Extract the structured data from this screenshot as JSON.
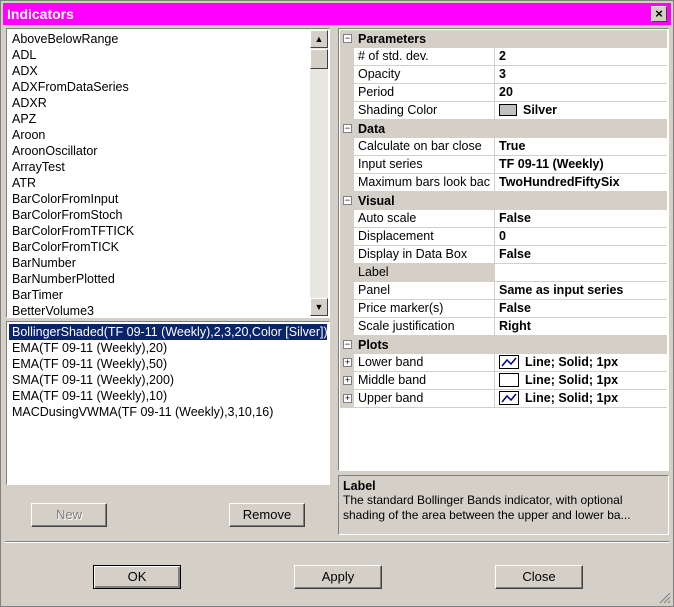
{
  "window": {
    "title": "Indicators"
  },
  "indicator_list": {
    "items": [
      "AboveBelowRange",
      "ADL",
      "ADX",
      "ADXFromDataSeries",
      "ADXR",
      "APZ",
      "Aroon",
      "AroonOscillator",
      "ArrayTest",
      "ATR",
      "BarColorFromInput",
      "BarColorFromStoch",
      "BarColorFromTFTICK",
      "BarColorFromTICK",
      "BarNumber",
      "BarNumberPlotted",
      "BarTimer",
      "BetterVolume3"
    ]
  },
  "applied_list": {
    "items": [
      "BollingerShaded(TF 09-11 (Weekly),2,3,20,Color [Silver])",
      "EMA(TF 09-11 (Weekly),20)",
      "EMA(TF 09-11 (Weekly),50)",
      "SMA(TF 09-11 (Weekly),200)",
      "EMA(TF 09-11 (Weekly),10)",
      "MACDusingVWMA(TF 09-11 (Weekly),3,10,16)"
    ]
  },
  "buttons": {
    "new": "New",
    "remove": "Remove",
    "ok": "OK",
    "apply": "Apply",
    "close": "Close"
  },
  "grid": {
    "parameters": {
      "label": "Parameters",
      "std_dev": {
        "name": "# of std. dev.",
        "value": "2"
      },
      "opacity": {
        "name": "Opacity",
        "value": "3"
      },
      "period": {
        "name": "Period",
        "value": "20"
      },
      "shading": {
        "name": "Shading Color",
        "value": "Silver"
      }
    },
    "data": {
      "label": "Data",
      "calc": {
        "name": "Calculate on bar close",
        "value": "True"
      },
      "input": {
        "name": "Input series",
        "value": "TF 09-11 (Weekly)"
      },
      "maxbars": {
        "name": "Maximum bars look bac",
        "value": "TwoHundredFiftySix"
      }
    },
    "visual": {
      "label": "Visual",
      "autoscale": {
        "name": "Auto scale",
        "value": "False"
      },
      "displacement": {
        "name": "Displacement",
        "value": "0"
      },
      "databox": {
        "name": "Display in Data Box",
        "value": "False"
      },
      "label_prop": {
        "name": "Label",
        "value": ""
      },
      "panel": {
        "name": "Panel",
        "value": "Same as input series"
      },
      "pricemarker": {
        "name": "Price marker(s)",
        "value": "False"
      },
      "scalejust": {
        "name": "Scale justification",
        "value": "Right"
      }
    },
    "plots": {
      "label": "Plots",
      "lower": {
        "name": "Lower band",
        "value": "Line; Solid; 1px"
      },
      "middle": {
        "name": "Middle band",
        "value": "Line; Solid; 1px"
      },
      "upper": {
        "name": "Upper band",
        "value": "Line; Solid; 1px"
      }
    }
  },
  "description": {
    "title": "Label",
    "text": "The standard Bollinger Bands indicator, with optional shading of the area between the upper and lower ba..."
  },
  "colors": {
    "title_bar": "#ff00ff",
    "selection": "#0a246a",
    "silver": "#c0c0c0",
    "plot_line": "#000080"
  }
}
